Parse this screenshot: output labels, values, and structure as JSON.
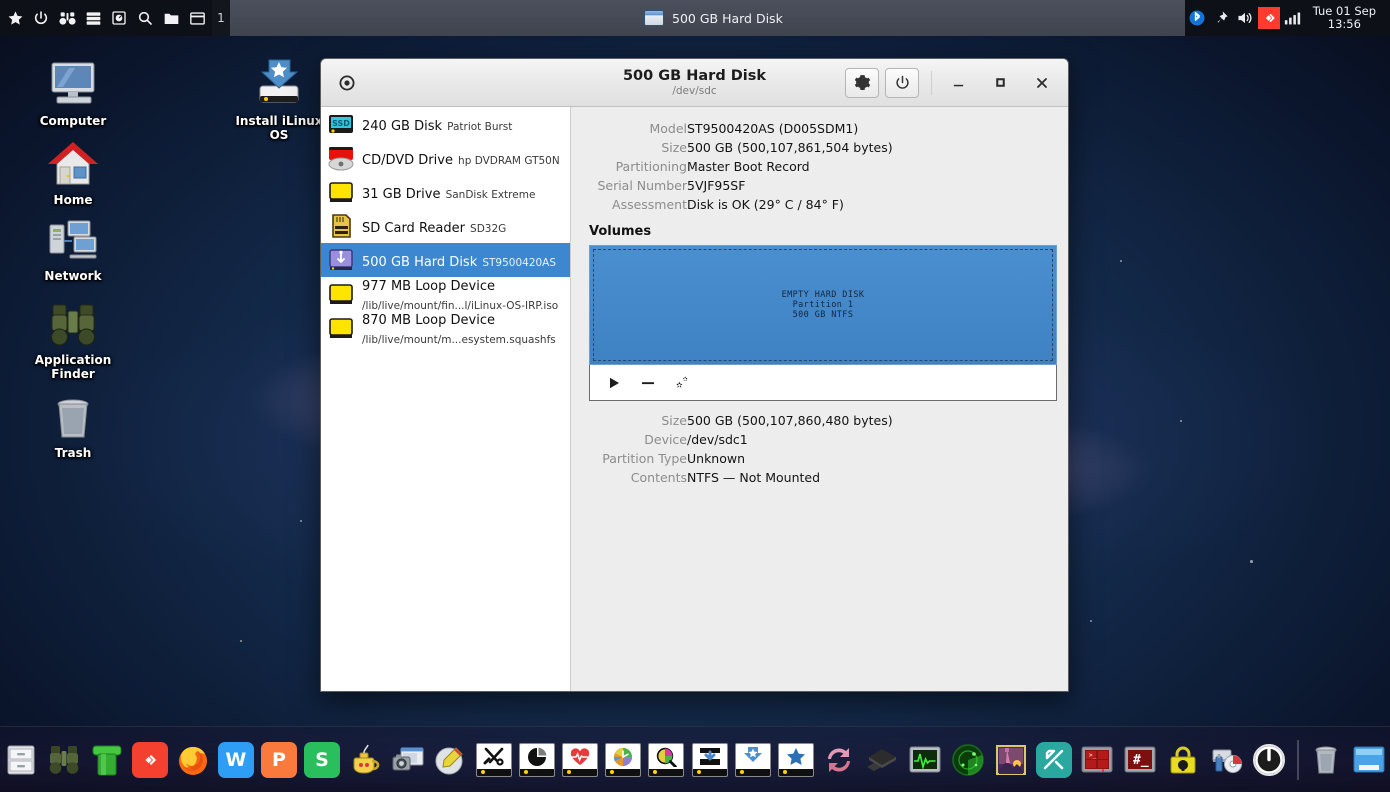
{
  "panel": {
    "launchers": [
      {
        "name": "star-menu-icon",
        "label": "Applications"
      },
      {
        "name": "power-icon",
        "label": "Log Out"
      },
      {
        "name": "binoculars-icon",
        "label": "Application Finder"
      },
      {
        "name": "server-icon",
        "label": "Task Manager"
      },
      {
        "name": "disk-monitor-icon",
        "label": "Disk Usage"
      },
      {
        "name": "search-icon",
        "label": "Search"
      },
      {
        "name": "folder-icon",
        "label": "File Manager"
      },
      {
        "name": "terminal-icon",
        "label": "Terminal"
      }
    ],
    "workspace": "1",
    "task": {
      "label": "500 GB Hard Disk"
    },
    "tray": [
      {
        "name": "bluetooth-icon"
      },
      {
        "name": "pin-icon"
      },
      {
        "name": "volume-icon"
      },
      {
        "name": "anydesk-icon"
      },
      {
        "name": "network-signal-icon"
      }
    ],
    "clock": {
      "date": "Tue 01 Sep",
      "time": "13:56"
    }
  },
  "desktop_icons": [
    {
      "name": "computer",
      "label": "Computer"
    },
    {
      "name": "home",
      "label": "Home"
    },
    {
      "name": "network",
      "label": "Network"
    },
    {
      "name": "application-finder",
      "label": "Application Finder"
    },
    {
      "name": "trash",
      "label": "Trash"
    },
    {
      "name": "install-ilinux-os",
      "label": "Install iLinux OS"
    }
  ],
  "window": {
    "title": "500 GB Hard Disk",
    "subtitle": "/dev/sdc",
    "app_icon": "disks-icon",
    "actions": [
      {
        "name": "drive-options-button",
        "icon": "gear-icon"
      },
      {
        "name": "power-off-drive-button",
        "icon": "power-icon"
      }
    ],
    "controls": [
      {
        "name": "minimize-button",
        "glyph": "_"
      },
      {
        "name": "maximize-button",
        "glyph": "□"
      },
      {
        "name": "close-button",
        "glyph": "✕"
      }
    ]
  },
  "devices": [
    {
      "title": "240 GB Disk",
      "subtitle": "Patriot Burst",
      "icon": "ssd-icon",
      "selected": false
    },
    {
      "title": "CD/DVD Drive",
      "subtitle": "hp      DVDRAM GT50N",
      "icon": "optical-drive-icon",
      "selected": false
    },
    {
      "title": "31 GB Drive",
      "subtitle": "SanDisk Extreme",
      "icon": "usb-drive-icon",
      "selected": false
    },
    {
      "title": "SD Card Reader",
      "subtitle": "SD32G",
      "icon": "sd-card-icon",
      "selected": false
    },
    {
      "title": "500 GB Hard Disk",
      "subtitle": "ST9500420AS",
      "icon": "usb-hard-disk-icon",
      "selected": true
    },
    {
      "title": "977 MB Loop Device",
      "subtitle": "/lib/live/mount/fin...l/iLinux-OS-IRP.iso",
      "icon": "loop-device-icon",
      "selected": false
    },
    {
      "title": "870 MB Loop Device",
      "subtitle": "/lib/live/mount/m...esystem.squashfs",
      "icon": "loop-device-icon",
      "selected": false
    }
  ],
  "drive_props": [
    {
      "key": "Model",
      "value": "ST9500420AS (D005SDM1)"
    },
    {
      "key": "Size",
      "value": "500 GB (500,107,861,504 bytes)"
    },
    {
      "key": "Partitioning",
      "value": "Master Boot Record"
    },
    {
      "key": "Serial Number",
      "value": "5VJF95SF"
    },
    {
      "key": "Assessment",
      "value": "Disk is OK (29° C / 84° F)"
    }
  ],
  "volumes": {
    "heading": "Volumes",
    "partition": {
      "line1": "EMPTY HARD DISK",
      "line2": "Partition 1",
      "line3": "500 GB NTFS",
      "fill_color": "#4288c8"
    },
    "toolbar": [
      {
        "name": "mount-volume-button",
        "icon": "play-icon"
      },
      {
        "name": "delete-partition-button",
        "icon": "minus-icon"
      },
      {
        "name": "volume-options-button",
        "icon": "gears-icon"
      }
    ]
  },
  "volume_props": [
    {
      "key": "Size",
      "value": "500 GB (500,107,860,480 bytes)"
    },
    {
      "key": "Device",
      "value": "/dev/sdc1"
    },
    {
      "key": "Partition Type",
      "value": "Unknown"
    },
    {
      "key": "Contents",
      "value": "NTFS — Not Mounted"
    }
  ],
  "dock": [
    {
      "name": "file-manager",
      "icon": "cabinet"
    },
    {
      "name": "application-finder",
      "icon": "binoculars"
    },
    {
      "name": "green-pipe",
      "icon": "pipe"
    },
    {
      "name": "anydesk",
      "icon": "anydesk"
    },
    {
      "name": "firefox",
      "icon": "firefox"
    },
    {
      "name": "wps-writer",
      "icon": "w"
    },
    {
      "name": "wps-presentation",
      "icon": "p"
    },
    {
      "name": "wps-spreadsheet",
      "icon": "s"
    },
    {
      "name": "genie",
      "icon": "lamp"
    },
    {
      "name": "screenshot",
      "icon": "camera"
    },
    {
      "name": "disc-writer",
      "icon": "disc-pen"
    },
    {
      "name": "settings-tools",
      "icon": "tools"
    },
    {
      "name": "disk-usage",
      "icon": "piechart"
    },
    {
      "name": "system-health",
      "icon": "heart"
    },
    {
      "name": "disk-analyzer",
      "icon": "colorwheel"
    },
    {
      "name": "disk-inspector",
      "icon": "magnifier-pie"
    },
    {
      "name": "downloader",
      "icon": "down-arrow"
    },
    {
      "name": "installer",
      "icon": "star-down"
    },
    {
      "name": "favorites",
      "icon": "star"
    },
    {
      "name": "sync",
      "icon": "refresh"
    },
    {
      "name": "archive",
      "icon": "stack"
    },
    {
      "name": "system-monitor",
      "icon": "oscilloscope"
    },
    {
      "name": "radar",
      "icon": "radar"
    },
    {
      "name": "image-viewer",
      "icon": "landscape"
    },
    {
      "name": "gparted",
      "icon": "partition-tool"
    },
    {
      "name": "gimp-like",
      "icon": "runner"
    },
    {
      "name": "terminal-red",
      "icon": "term-red"
    },
    {
      "name": "root-terminal",
      "icon": "term-hash"
    },
    {
      "name": "password-manager",
      "icon": "lock-gear"
    },
    {
      "name": "usb-creator",
      "icon": "usb-disc"
    },
    {
      "name": "shutdown",
      "icon": "power"
    },
    {
      "name": "trash",
      "icon": "bin"
    },
    {
      "name": "show-desktop",
      "icon": "desktop"
    }
  ]
}
